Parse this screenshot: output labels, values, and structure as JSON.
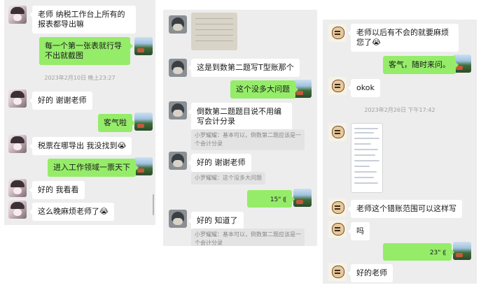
{
  "panel1": {
    "msg1": "老师 纳税工作台上所有的报表都导出嘛",
    "msg2": "每一个第一张表就行导不出就截图",
    "timestamp": "2023年2月10日 晚上23:27",
    "msg3": "好的 谢谢老师",
    "msg4": "客气啦",
    "msg5": "税票在哪导出 我没找到😭",
    "msg6": "进入工作领域一票天下",
    "msg7": "好的 我看看",
    "msg8": "这么晚麻烦老师了😭"
  },
  "panel2": {
    "msg1": "这是到数第二题写T型账那个",
    "msg2": "这个没多大问题",
    "msg3": "倒数第二题题目说不用编写会计分录",
    "quote1": "小罗耀耀：基本可以，倒数第二题应该是一个会计分录",
    "msg4": "好的 谢谢老师",
    "quote2": "小罗耀耀：这个没多大问题",
    "voice": "15\"",
    "msg5": "好的 知道了",
    "quote3": "小罗耀耀：基本可以，倒数第二题应该是一个会计分录"
  },
  "panel3": {
    "msg1": "老师以后有不会的就要麻烦您了😭",
    "msg2": "客气，随时来问。",
    "msg3": "okok",
    "timestamp": "2023年2月26日 下午17:42",
    "msg4": "老师这个错账范围可以这样写",
    "msg5": "吗",
    "voice": "23\"",
    "msg6": "好的老师"
  },
  "icons": {
    "voice": "voice-wave-icon",
    "emoji": "crying-emoji"
  },
  "colors": {
    "outgoing_bubble": "#95ec69",
    "incoming_bubble": "#ffffff",
    "chat_background": "#ededed"
  }
}
